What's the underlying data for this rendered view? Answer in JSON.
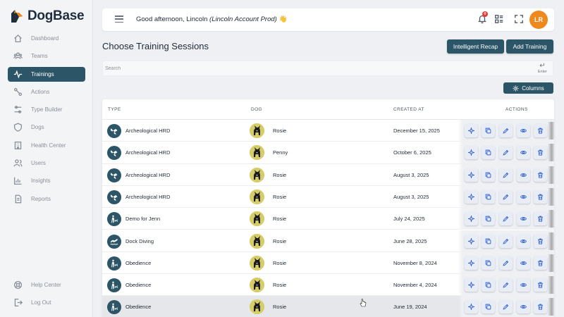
{
  "app": {
    "name": "DogBase"
  },
  "sidebar": {
    "items": [
      {
        "label": "Dashboard",
        "icon": "home-icon",
        "active": false
      },
      {
        "label": "Teams",
        "icon": "teams-icon",
        "active": false
      },
      {
        "label": "Trainings",
        "icon": "activity-icon",
        "active": true
      },
      {
        "label": "Actions",
        "icon": "route-icon",
        "active": false
      },
      {
        "label": "Type Builder",
        "icon": "sliders-icon",
        "active": false
      },
      {
        "label": "Dogs",
        "icon": "shield-dog-icon",
        "active": false
      },
      {
        "label": "Health Center",
        "icon": "building-icon",
        "active": false
      },
      {
        "label": "Users",
        "icon": "users-icon",
        "active": false
      },
      {
        "label": "Insights",
        "icon": "chart-icon",
        "active": false
      },
      {
        "label": "Reports",
        "icon": "document-icon",
        "active": false
      }
    ],
    "bottom": [
      {
        "label": "Help Center",
        "icon": "lifebuoy-icon"
      },
      {
        "label": "Log Out",
        "icon": "logout-icon"
      }
    ]
  },
  "header": {
    "greeting": "Good afternoon, Lincoln ",
    "account": "(Lincoln Account Prod)",
    "wave": "👋",
    "notification_count": "0",
    "avatar_initials": "LR"
  },
  "page": {
    "title": "Choose Training Sessions",
    "recap_label": "Intelligent Recap",
    "add_label": "Add Training",
    "search_placeholder": "Search",
    "enter_label": "Enter",
    "columns_label": "Columns"
  },
  "table": {
    "headers": {
      "type": "TYPE",
      "dog": "DOG",
      "created": "CREATED AT",
      "actions": "ACTIONS"
    },
    "rows": [
      {
        "type": "Archeological HRD",
        "type_icon": "hrd-icon",
        "dog": "Rosie",
        "created": "December 15, 2025"
      },
      {
        "type": "Archeological HRD",
        "type_icon": "hrd-icon",
        "dog": "Penny",
        "created": "October 6, 2025"
      },
      {
        "type": "Archeological HRD",
        "type_icon": "hrd-icon",
        "dog": "Rosie",
        "created": "August 3, 2025"
      },
      {
        "type": "Archeological HRD",
        "type_icon": "hrd-icon",
        "dog": "Rosie",
        "created": "August 3, 2025"
      },
      {
        "type": "Demo for Jenn",
        "type_icon": "handler-dog-icon",
        "dog": "Rosie",
        "created": "July 24, 2025"
      },
      {
        "type": "Dock Diving",
        "type_icon": "dock-diving-icon",
        "dog": "Rosie",
        "created": "June 28, 2025"
      },
      {
        "type": "Obedience",
        "type_icon": "handler-dog-icon",
        "dog": "Rosie",
        "created": "November 8, 2024"
      },
      {
        "type": "Obedience",
        "type_icon": "handler-dog-icon",
        "dog": "Rosie",
        "created": "November 4, 2024"
      },
      {
        "type": "Obedience",
        "type_icon": "handler-dog-icon",
        "dog": "Rosie",
        "created": "June 19, 2024"
      }
    ],
    "action_icons": [
      "sparkle-icon",
      "copy-icon",
      "pencil-icon",
      "eye-icon",
      "trash-icon"
    ]
  },
  "colors": {
    "primary": "#2c5567",
    "accent": "#ee8a1d",
    "action_icon": "#2f5fd0",
    "badge": "#e53935"
  }
}
